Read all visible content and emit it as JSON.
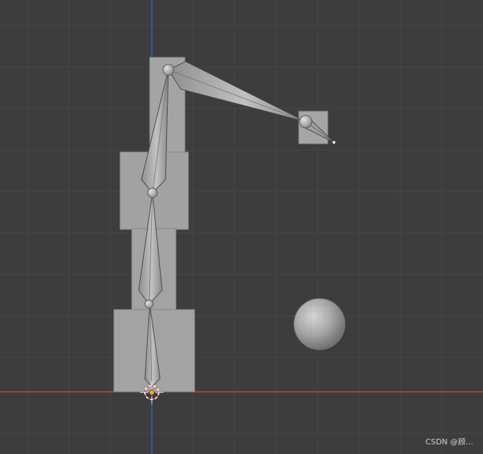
{
  "viewport": {
    "background_color": "#3d3d3d",
    "grid_color": "#4a4a4a",
    "x_axis_color": "#c24040",
    "y_axis_color": "#2f65b8",
    "mesh_color": "#9f9f9f",
    "bone_color": "#a7a7a7",
    "origin_color": "#f5a623"
  },
  "scene_objects": [
    {
      "name": "bottom-box"
    },
    {
      "name": "lower-middle-box"
    },
    {
      "name": "middle-box"
    },
    {
      "name": "upper-tower-box"
    },
    {
      "name": "end-cube"
    },
    {
      "name": "sphere"
    }
  ],
  "armature": {
    "bones": [
      "bone-1",
      "bone-2",
      "bone-3",
      "bone-4",
      "bone-5"
    ]
  },
  "watermark": {
    "text": "CSDN @顾..."
  }
}
